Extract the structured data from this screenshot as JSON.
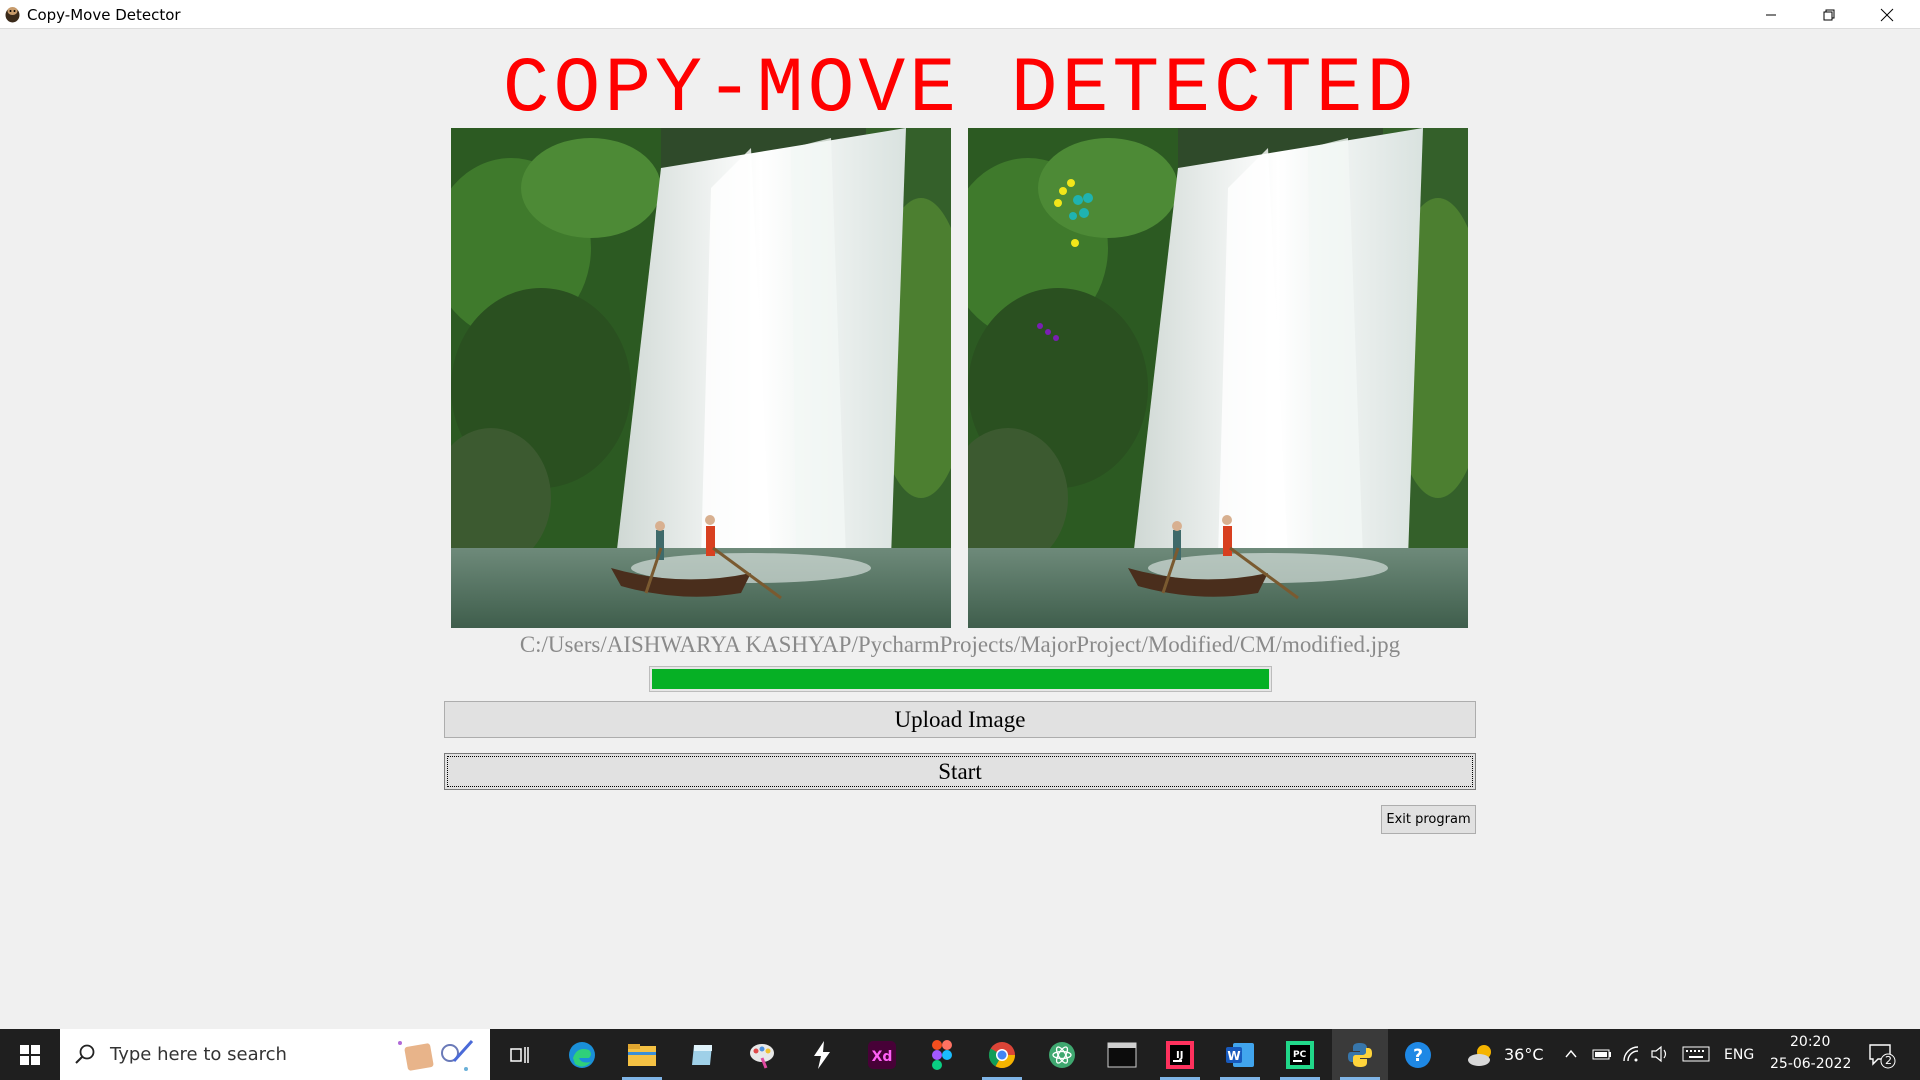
{
  "window": {
    "title": "Copy-Move Detector",
    "controls": [
      "minimize-icon",
      "restore-icon",
      "close-icon"
    ]
  },
  "main": {
    "headline": "COPY-MOVE DETECTED",
    "headline_color": "#ff0000",
    "original_image_alt": "original waterfall image",
    "result_image_alt": "waterfall image with copy-move keypoint markers",
    "file_path": "C:/Users/AISHWARYA KASHYAP/PycharmProjects/MajorProject/Modified/CM/modified.jpg",
    "progress_percent": 100,
    "progress_color": "#06b025",
    "upload_button": "Upload Image",
    "start_button": "Start",
    "exit_button": "Exit program"
  },
  "taskbar": {
    "search_placeholder": "Type here to search",
    "apps": [
      "task-view-icon",
      "edge-icon",
      "file-explorer-icon",
      "notes-icon",
      "paint-icon",
      "spark-icon",
      "adobe-xd-icon",
      "figma-icon",
      "chrome-icon",
      "atom-icon",
      "terminal-icon",
      "intellij-icon",
      "word-icon",
      "pycharm-icon",
      "python-icon",
      "help-icon"
    ],
    "weather": "36°C",
    "language": "ENG",
    "time": "20:20",
    "date": "25-06-2022",
    "notification_count": "2"
  }
}
